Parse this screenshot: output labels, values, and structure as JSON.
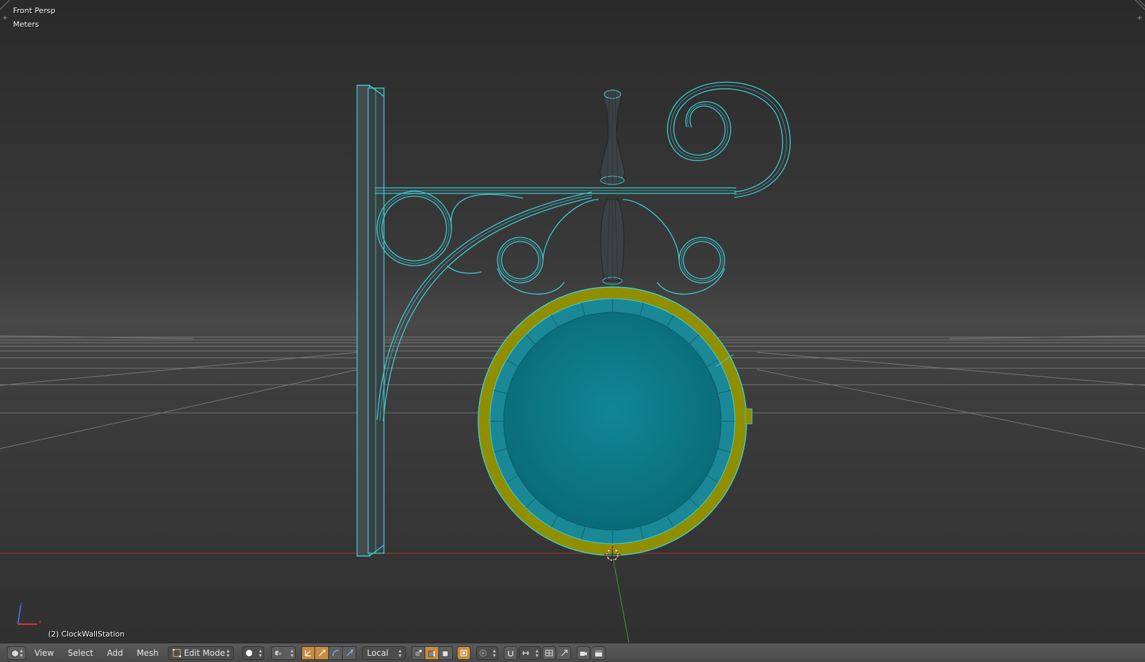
{
  "viewport": {
    "view_name": "Front Persp",
    "units": "Meters",
    "object_label": "(2) ClockWallStation",
    "axis_x_label": "x",
    "axis_z_label": "z"
  },
  "header": {
    "menus": [
      "View",
      "Select",
      "Add",
      "Mesh"
    ],
    "mode": "Edit Mode",
    "orientation": "Local"
  },
  "colors": {
    "mesh_wire": "#3bd0d8",
    "face_fill": "#0e8191",
    "selected_ring": "#8f8f00",
    "grid": "#8c8c8c",
    "x_axis": "#b03030",
    "y_axis": "#3ca03c",
    "active_button": "#c88b3f"
  },
  "icons": {
    "editor_type": "3d-view-icon",
    "mode": "edit-mode-icon",
    "shading": "solid-sphere-icon",
    "pivot": "pivot-point-icon",
    "manipulators": [
      "manipulator-icon",
      "translate-icon",
      "rotate-icon",
      "scale-icon"
    ],
    "select_modes": [
      "vertex-select-icon",
      "edge-select-icon",
      "face-select-icon"
    ],
    "extra": [
      "limit-selection-icon",
      "proportional-edit-icon",
      "snap-icon",
      "snap-target-icon",
      "mirror-icon",
      "render-icon",
      "clapper-icon"
    ]
  }
}
